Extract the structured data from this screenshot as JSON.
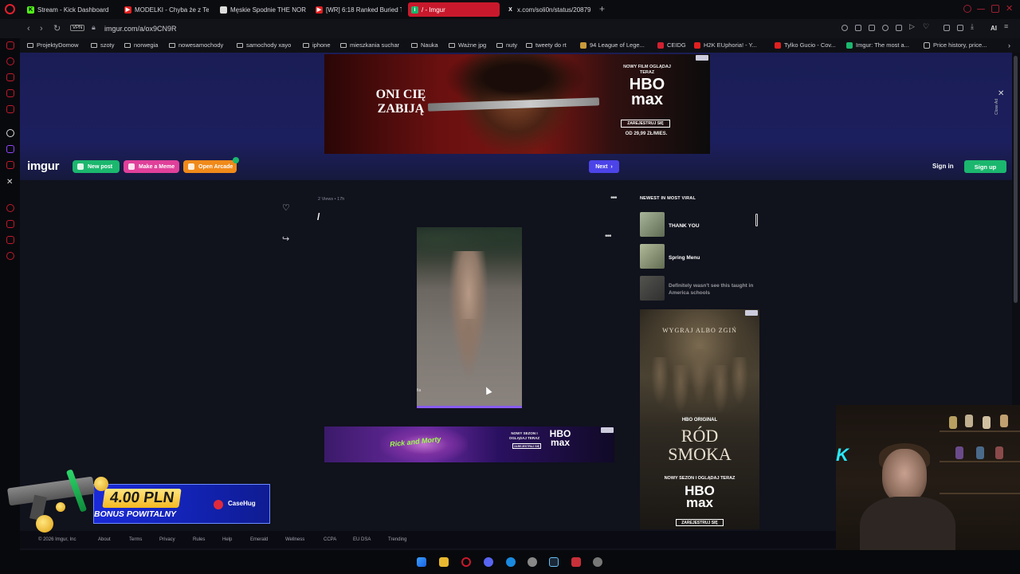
{
  "browser": {
    "tabs": [
      {
        "label": "Stream - Kick Dashboard",
        "color": "#53fc18",
        "icon": "kick-icon"
      },
      {
        "label": "MODELKI - Chyba że z Te",
        "color": "#e02020",
        "icon": "youtube-icon"
      },
      {
        "label": "Męskie Spodnie THE NOR",
        "color": "#dddddd",
        "icon": "shop-icon"
      },
      {
        "label": "[WR] 6:18 Ranked Buried T",
        "color": "#e02020",
        "icon": "youtube-icon"
      },
      {
        "label": "/ - Imgur",
        "color": "#1bb76e",
        "icon": "imgur-icon"
      },
      {
        "label": "x.com/soli0n/status/20879",
        "color": "#ffffff",
        "icon": "x-icon"
      }
    ],
    "vpn_label": "VPN",
    "url": "imgur.com/a/ox9CN9R",
    "ai_label": "AI",
    "bookmarks": [
      {
        "label": "ProjektyDomow",
        "kind": "folder"
      },
      {
        "label": "szoty",
        "kind": "folder"
      },
      {
        "label": "norwegia",
        "kind": "folder"
      },
      {
        "label": "nowesamochody",
        "kind": "folder"
      },
      {
        "label": "samochody xayo",
        "kind": "folder"
      },
      {
        "label": "iphone",
        "kind": "folder"
      },
      {
        "label": "mieszkania suchar",
        "kind": "folder"
      },
      {
        "label": "Nauka",
        "kind": "folder"
      },
      {
        "label": "Ważne jpg",
        "kind": "folder"
      },
      {
        "label": "nuty",
        "kind": "folder"
      },
      {
        "label": "tweety do rt",
        "kind": "folder"
      },
      {
        "label": "94 League of Lege...",
        "kind": "site"
      },
      {
        "label": "CEIDG",
        "kind": "site"
      },
      {
        "label": "H2K EUphoria! - Y...",
        "kind": "site"
      },
      {
        "label": "Tylko Gucio - Cov...",
        "kind": "site"
      },
      {
        "label": "Imgur: The most a...",
        "kind": "site"
      },
      {
        "label": "Price history, price...",
        "kind": "site"
      }
    ]
  },
  "top_ad": {
    "headline": "ONI CIĘ ZABIJĄ",
    "kicker": "NOWY FILM OGLĄDAJ TERAZ",
    "brand_line1": "HBO",
    "brand_line2": "max",
    "button": "ZAREJESTRUJ SIĘ",
    "price": "OD 29,99 ZŁ/MIES.",
    "close_label": "Close Ad"
  },
  "header": {
    "logo": "imgur",
    "new_post": "New post",
    "make_meme": "Make a Meme",
    "open_arcade": "Open Arcade",
    "next": "Next",
    "sign_in": "Sign in",
    "sign_up": "Sign up"
  },
  "post": {
    "meta": "2 Views • 17h",
    "title": "/",
    "video_progress": 1.0
  },
  "mid_ad": {
    "show": "Rick and Morty",
    "kicker": "NOWY SEZON I OGLĄDAJ TERAZ",
    "brand": "HBO max",
    "button": "ZAREJESTRUJ SIĘ"
  },
  "newest": {
    "title": "NEWEST IN MOST VIRAL",
    "items": [
      {
        "title": "THANK YOU",
        "color": "#7a8a6a"
      },
      {
        "title": "Spring Menu",
        "color": "#7e8a70"
      },
      {
        "title": "Definitely wasn't see this taught in America schools",
        "color": "#6a6a60"
      }
    ]
  },
  "side_ad": {
    "top_text": "WYGRAJ ALBO ZGIŃ",
    "brand_small": "HBO ORIGINAL",
    "title1": "RÓD",
    "title2": "SMOKA",
    "sub": "NOWY SEZON I OGLĄDAJ TERAZ",
    "brand_big1": "HBO",
    "brand_big2": "max",
    "button": "ZAREJESTRUJ SIĘ"
  },
  "footer": {
    "copyright": "© 2026 Imgur, Inc",
    "links": [
      "About",
      "Terms",
      "Privacy",
      "Rules",
      "Help",
      "Emerald",
      "Wellness",
      "CCPA",
      "EU DSA",
      "Trending"
    ]
  },
  "promo": {
    "amount": "4.00 PLN",
    "subtitle": "BONUS POWITALNY",
    "brand": "CaseHug"
  }
}
